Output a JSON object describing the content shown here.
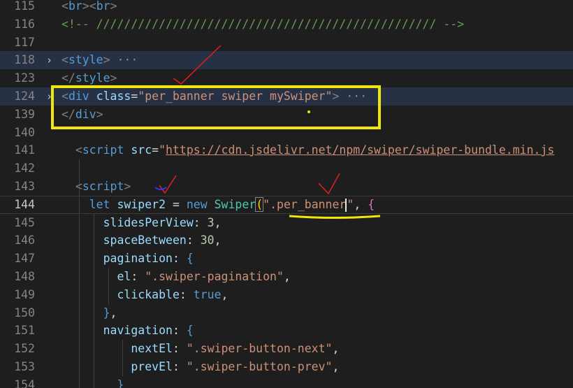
{
  "lines": [
    {
      "num": "115",
      "fold": "",
      "highlight": false,
      "tokens": [
        {
          "t": "<",
          "c": "tag"
        },
        {
          "t": "br",
          "c": "name"
        },
        {
          "t": "><",
          "c": "tag"
        },
        {
          "t": "br",
          "c": "name"
        },
        {
          "t": ">",
          "c": "tag"
        }
      ]
    },
    {
      "num": "116",
      "fold": "",
      "highlight": false,
      "tokens": [
        {
          "t": "<!-- ///////////////////////////////////////////////// -->",
          "c": "com"
        }
      ]
    },
    {
      "num": "117",
      "fold": "",
      "highlight": false,
      "tokens": []
    },
    {
      "num": "118",
      "fold": "›",
      "highlight": true,
      "tokens": [
        {
          "t": "<",
          "c": "tag"
        },
        {
          "t": "style",
          "c": "name"
        },
        {
          "t": ">",
          "c": "tag"
        },
        {
          "t": " ···",
          "c": "ell"
        }
      ]
    },
    {
      "num": "123",
      "fold": "",
      "highlight": false,
      "tokens": [
        {
          "t": "</",
          "c": "tag"
        },
        {
          "t": "style",
          "c": "name"
        },
        {
          "t": ">",
          "c": "tag"
        }
      ]
    },
    {
      "num": "124",
      "fold": "›",
      "highlight": true,
      "tokens": [
        {
          "t": "<",
          "c": "tag"
        },
        {
          "t": "div",
          "c": "name"
        },
        {
          "t": " ",
          "c": "plain"
        },
        {
          "t": "class",
          "c": "attr"
        },
        {
          "t": "=",
          "c": "plain"
        },
        {
          "t": "\"per_banner swiper mySwiper\"",
          "c": "str"
        },
        {
          "t": ">",
          "c": "tag"
        },
        {
          "t": " ···",
          "c": "ell"
        }
      ]
    },
    {
      "num": "139",
      "fold": "",
      "highlight": false,
      "tokens": [
        {
          "t": "</",
          "c": "tag"
        },
        {
          "t": "div",
          "c": "name"
        },
        {
          "t": ">",
          "c": "tag"
        }
      ]
    },
    {
      "num": "140",
      "fold": "",
      "highlight": false,
      "tokens": []
    },
    {
      "num": "141",
      "fold": "",
      "highlight": false,
      "tokens": [
        {
          "t": "  ",
          "c": "plain"
        },
        {
          "t": "<",
          "c": "tag"
        },
        {
          "t": "script",
          "c": "name"
        },
        {
          "t": " ",
          "c": "plain"
        },
        {
          "t": "src",
          "c": "attr"
        },
        {
          "t": "=",
          "c": "plain"
        },
        {
          "t": "\"",
          "c": "str"
        },
        {
          "t": "https://cdn.jsdelivr.net/npm/swiper/swiper-bundle.min.js",
          "c": "str link"
        }
      ]
    },
    {
      "num": "142",
      "fold": "",
      "highlight": false,
      "tokens": []
    },
    {
      "num": "143",
      "fold": "",
      "highlight": false,
      "tokens": [
        {
          "t": "  ",
          "c": "plain"
        },
        {
          "t": "<",
          "c": "tag"
        },
        {
          "t": "script",
          "c": "name"
        },
        {
          "t": ">",
          "c": "tag"
        }
      ]
    },
    {
      "num": "144",
      "fold": "",
      "highlight": false,
      "current": true,
      "tokens": [
        {
          "t": "    ",
          "c": "plain"
        },
        {
          "t": "let",
          "c": "kw"
        },
        {
          "t": " ",
          "c": "plain"
        },
        {
          "t": "swiper2",
          "c": "var"
        },
        {
          "t": " = ",
          "c": "plain"
        },
        {
          "t": "new",
          "c": "kw"
        },
        {
          "t": " ",
          "c": "plain"
        },
        {
          "t": "Swiper",
          "c": "cls"
        },
        {
          "t": "(",
          "c": "br1 match"
        },
        {
          "t": "\".per_banner",
          "c": "str"
        },
        {
          "t": "",
          "c": "caret"
        },
        {
          "t": "\"",
          "c": "str"
        },
        {
          "t": ", ",
          "c": "plain"
        },
        {
          "t": "{",
          "c": "br2"
        }
      ]
    },
    {
      "num": "145",
      "fold": "",
      "highlight": false,
      "tokens": [
        {
          "t": "      ",
          "c": "plain"
        },
        {
          "t": "slidesPerView",
          "c": "var"
        },
        {
          "t": ": ",
          "c": "plain"
        },
        {
          "t": "3",
          "c": "num"
        },
        {
          "t": ",",
          "c": "plain"
        }
      ]
    },
    {
      "num": "146",
      "fold": "",
      "highlight": false,
      "tokens": [
        {
          "t": "      ",
          "c": "plain"
        },
        {
          "t": "spaceBetween",
          "c": "var"
        },
        {
          "t": ": ",
          "c": "plain"
        },
        {
          "t": "30",
          "c": "num"
        },
        {
          "t": ",",
          "c": "plain"
        }
      ]
    },
    {
      "num": "147",
      "fold": "",
      "highlight": false,
      "tokens": [
        {
          "t": "      ",
          "c": "plain"
        },
        {
          "t": "pagination",
          "c": "var"
        },
        {
          "t": ": ",
          "c": "plain"
        },
        {
          "t": "{",
          "c": "kw"
        }
      ]
    },
    {
      "num": "148",
      "fold": "",
      "highlight": false,
      "tokens": [
        {
          "t": "        ",
          "c": "plain"
        },
        {
          "t": "el",
          "c": "var"
        },
        {
          "t": ": ",
          "c": "plain"
        },
        {
          "t": "\".swiper-pagination\"",
          "c": "str"
        },
        {
          "t": ",",
          "c": "plain"
        }
      ]
    },
    {
      "num": "149",
      "fold": "",
      "highlight": false,
      "tokens": [
        {
          "t": "        ",
          "c": "plain"
        },
        {
          "t": "clickable",
          "c": "var"
        },
        {
          "t": ": ",
          "c": "plain"
        },
        {
          "t": "true",
          "c": "kw"
        },
        {
          "t": ",",
          "c": "plain"
        }
      ]
    },
    {
      "num": "150",
      "fold": "",
      "highlight": false,
      "tokens": [
        {
          "t": "      ",
          "c": "plain"
        },
        {
          "t": "}",
          "c": "kw"
        },
        {
          "t": ",",
          "c": "plain"
        }
      ]
    },
    {
      "num": "151",
      "fold": "",
      "highlight": false,
      "tokens": [
        {
          "t": "      ",
          "c": "plain"
        },
        {
          "t": "navigation",
          "c": "var"
        },
        {
          "t": ": ",
          "c": "plain"
        },
        {
          "t": "{",
          "c": "kw"
        }
      ]
    },
    {
      "num": "152",
      "fold": "",
      "highlight": false,
      "tokens": [
        {
          "t": "          ",
          "c": "plain"
        },
        {
          "t": "nextEl",
          "c": "var"
        },
        {
          "t": ": ",
          "c": "plain"
        },
        {
          "t": "\".swiper-button-next\"",
          "c": "str"
        },
        {
          "t": ",",
          "c": "plain"
        }
      ]
    },
    {
      "num": "153",
      "fold": "",
      "highlight": false,
      "tokens": [
        {
          "t": "          ",
          "c": "plain"
        },
        {
          "t": "prevEl",
          "c": "var"
        },
        {
          "t": ": ",
          "c": "plain"
        },
        {
          "t": "\".swiper-button-prev\"",
          "c": "str"
        },
        {
          "t": ",",
          "c": "plain"
        }
      ]
    },
    {
      "num": "154",
      "fold": "",
      "highlight": false,
      "tokens": [
        {
          "t": "        ",
          "c": "plain"
        },
        {
          "t": "}",
          "c": "kw"
        }
      ]
    }
  ],
  "colors": {
    "background": "#1e1e1e",
    "annotation_box": "#f0e60a",
    "annotation_check": "#e02020",
    "annotation_underline": "#f0e60a",
    "annotation_blue_mark": "#2b3bff"
  }
}
